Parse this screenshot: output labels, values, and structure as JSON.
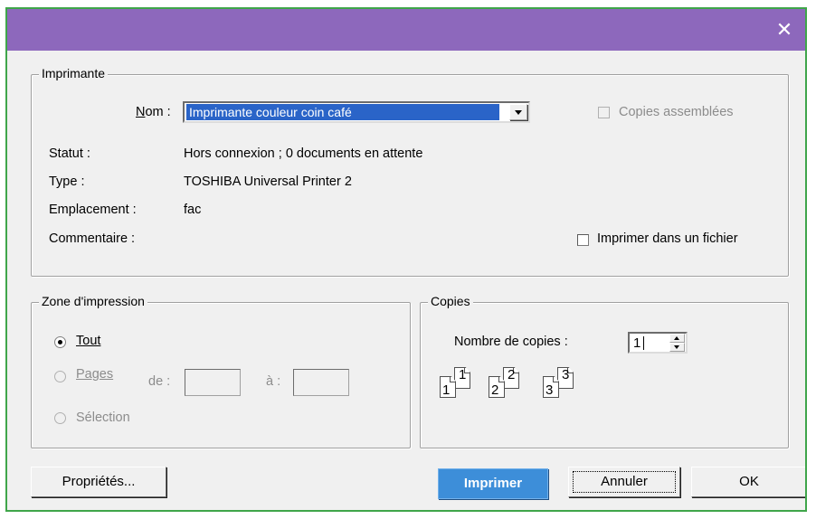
{
  "window": {
    "close_glyph": "✕"
  },
  "printer": {
    "legend": "Imprimante",
    "name_label": "Nom :",
    "selected_printer": "Imprimante couleur coin café",
    "collate_label": "Copies assemblées",
    "status_label": "Statut :",
    "status_value": "Hors connexion ; 0 documents en attente",
    "type_label": "Type :",
    "type_value": "TOSHIBA Universal Printer 2",
    "location_label": "Emplacement :",
    "location_value": "fac",
    "comment_label": "Commentaire :",
    "print_to_file_label": "Imprimer dans un fichier"
  },
  "print_range": {
    "legend": "Zone d'impression",
    "all_label": "Tout",
    "pages_label": "Pages",
    "from_label": "de :",
    "to_label": "à :",
    "selection_label": "Sélection"
  },
  "copies": {
    "legend": "Copies",
    "count_label": "Nombre de copies :",
    "count_value": "1",
    "collate_pages": [
      "1",
      "1",
      "2",
      "2",
      "3",
      "3"
    ]
  },
  "buttons": {
    "properties": "Propriétés...",
    "print": "Imprimer",
    "cancel": "Annuler",
    "ok": "OK"
  },
  "colors": {
    "titlebar": "#8d68bc",
    "primary_button": "#3d8ed9",
    "selection_highlight": "#2a64c8",
    "window_border": "#3fa54a"
  },
  "icons": [
    "close-icon",
    "dropdown-arrow-icon",
    "spin-up-icon",
    "spin-down-icon",
    "collate-pages-icon"
  ]
}
